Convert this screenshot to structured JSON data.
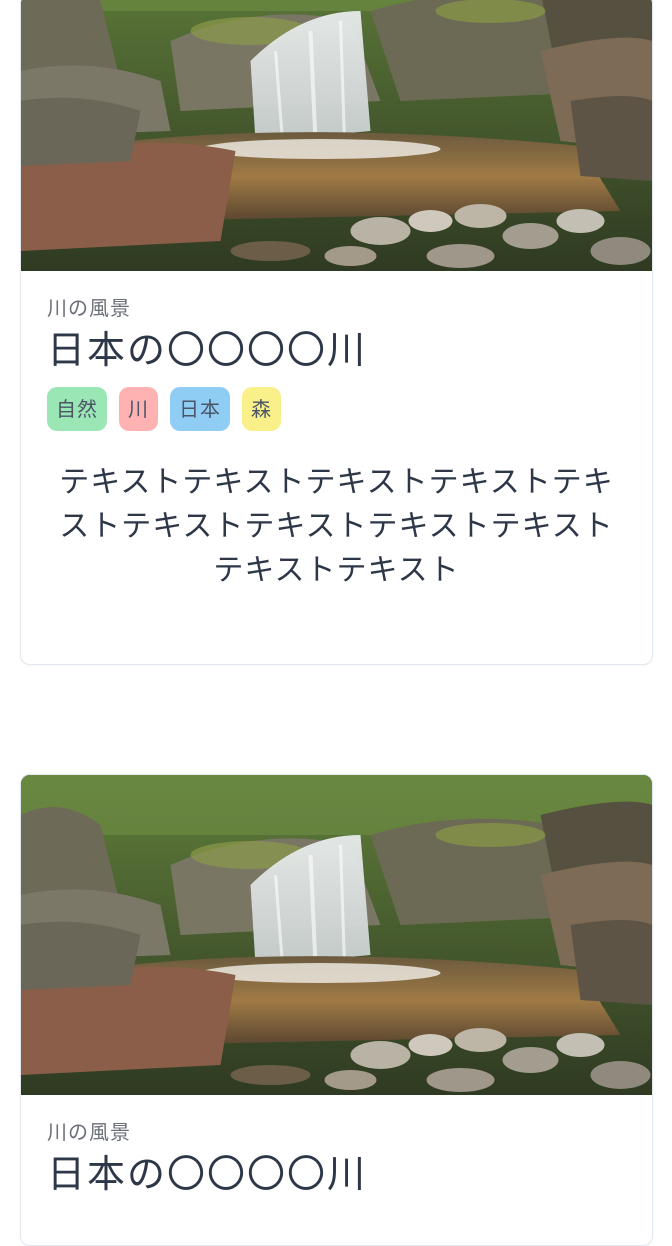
{
  "cards": [
    {
      "image_alt": "滝のある川の風景",
      "subtitle": "川の風景",
      "title": "日本の〇〇〇〇川",
      "tags": [
        {
          "label": "自然",
          "color": "#9ae6b4"
        },
        {
          "label": "川",
          "color": "#feb2b2"
        },
        {
          "label": "日本",
          "color": "#90cdf4"
        },
        {
          "label": "森",
          "color": "#faf089"
        }
      ],
      "description": "テキストテキストテキストテキストテキストテキストテキストテキストテキストテキストテキスト"
    },
    {
      "image_alt": "滝のある川の風景",
      "subtitle": "川の風景",
      "title": "日本の〇〇〇〇川"
    }
  ]
}
